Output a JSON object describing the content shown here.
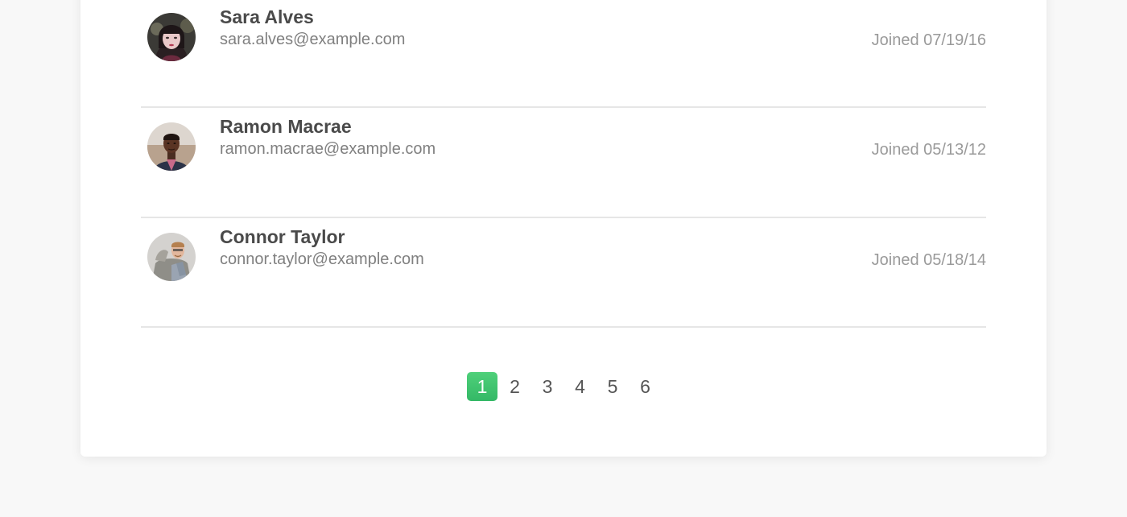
{
  "users": [
    {
      "name": "Sara Alves",
      "email": "sara.alves@example.com",
      "joined": "Joined 07/19/16"
    },
    {
      "name": "Ramon Macrae",
      "email": "ramon.macrae@example.com",
      "joined": "Joined 05/13/12"
    },
    {
      "name": "Connor Taylor",
      "email": "connor.taylor@example.com",
      "joined": "Joined 05/18/14"
    }
  ],
  "pagination": {
    "pages": [
      "1",
      "2",
      "3",
      "4",
      "5",
      "6"
    ],
    "active": "1"
  },
  "colors": {
    "accent": "#3cc46e",
    "background": "#f8f8f8",
    "card": "#ffffff",
    "divider": "#e6e6e6"
  }
}
